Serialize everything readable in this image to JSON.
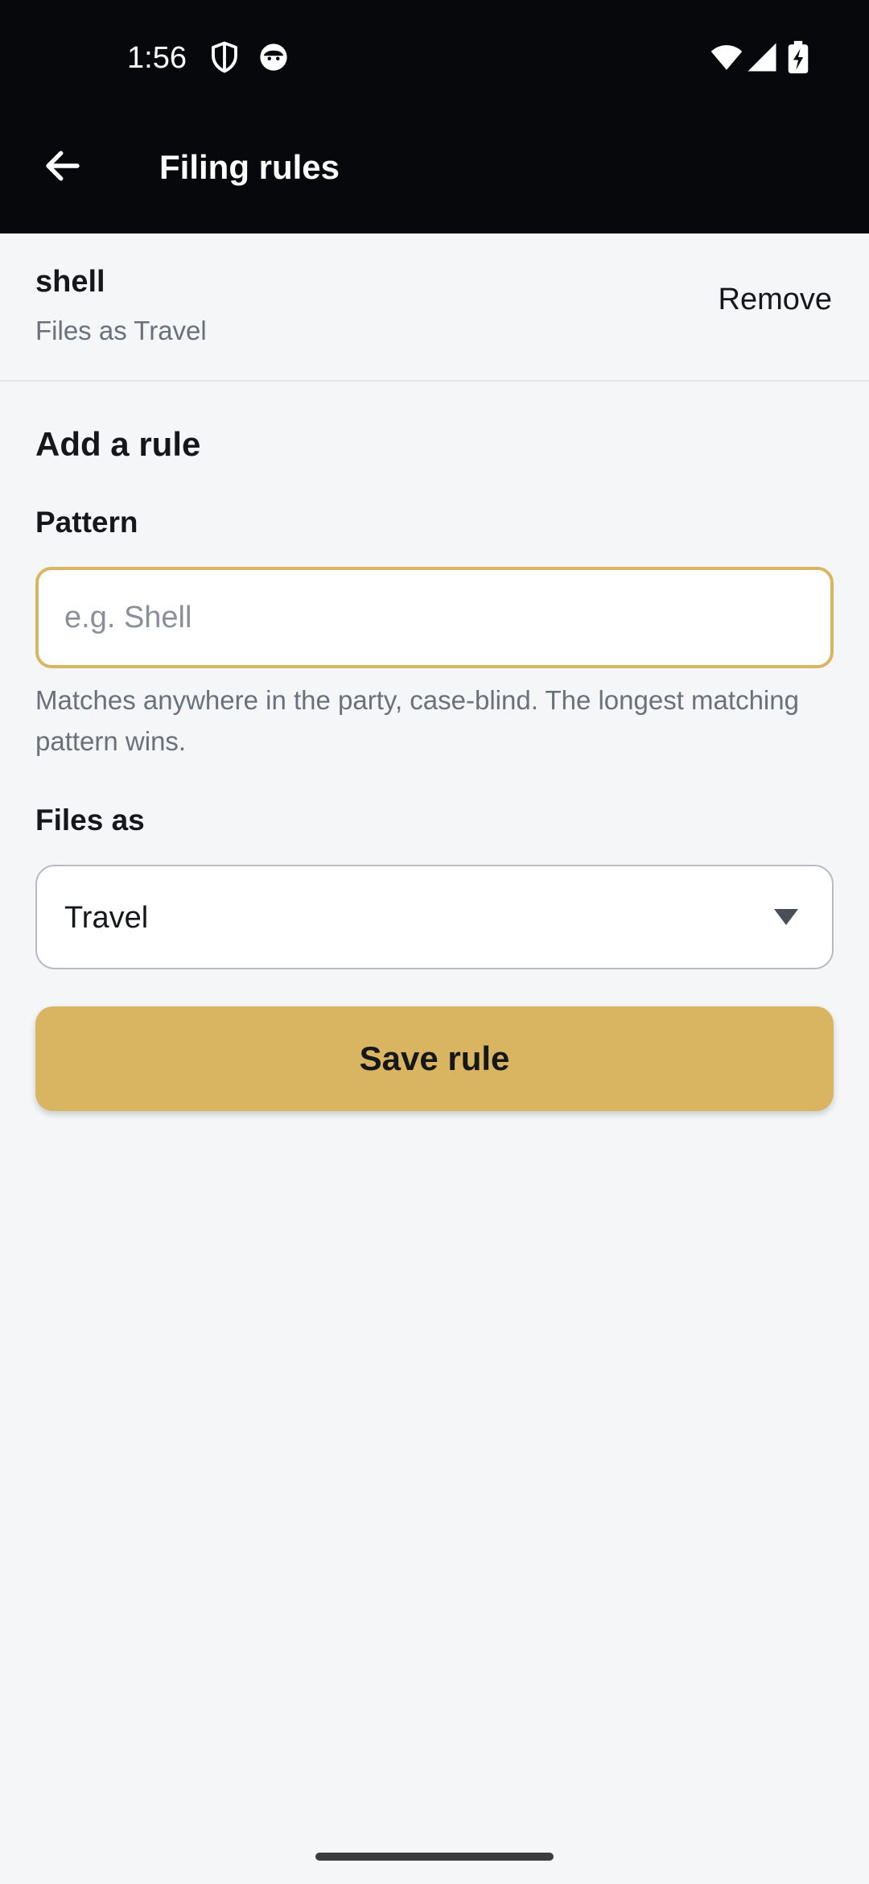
{
  "status_bar": {
    "time": "1:56",
    "icons": [
      "shield-icon",
      "face-icon",
      "wifi-icon",
      "signal-icon",
      "battery-charging-icon"
    ]
  },
  "app_bar": {
    "title": "Filing rules",
    "back_icon": "arrow-left-icon"
  },
  "existing_rule": {
    "pattern": "shell",
    "files_as": "Files as Travel",
    "remove_label": "Remove"
  },
  "add_rule": {
    "section_title": "Add a rule",
    "pattern_label": "Pattern",
    "pattern_value": "",
    "pattern_placeholder": "e.g. Shell",
    "pattern_helper": "Matches anywhere in the party, case-blind. The longest matching pattern wins.",
    "files_as_label": "Files as",
    "files_as_value": "Travel",
    "save_label": "Save rule"
  },
  "colors": {
    "accent": "#d9b562",
    "bar_background": "#07080b",
    "page_background": "#f4f6f8"
  }
}
